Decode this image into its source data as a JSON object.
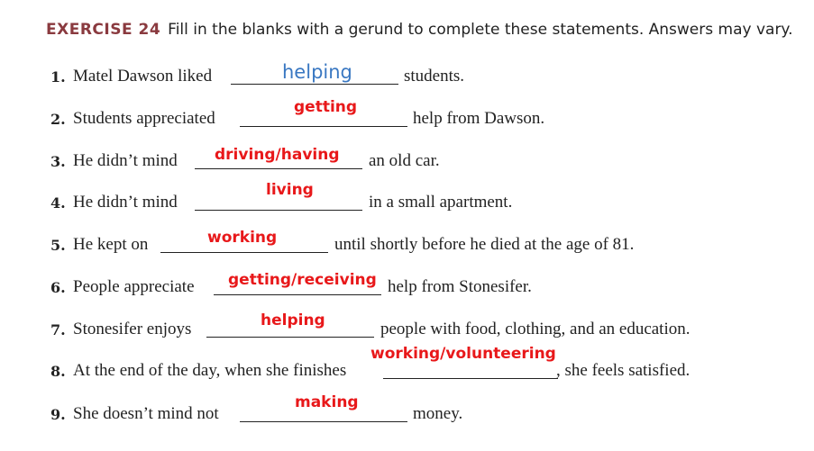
{
  "header": {
    "label": "EXERCISE 24",
    "instruction": "Fill in the blanks with a gerund to complete these statements. Answers may vary."
  },
  "items": [
    {
      "number": "1.",
      "before": "Matel Dawson liked",
      "answer": "helping",
      "after": "students."
    },
    {
      "number": "2.",
      "before": "Students appreciated",
      "answer": "getting",
      "after": "help from Dawson."
    },
    {
      "number": "3.",
      "before": "He didn’t mind",
      "answer": "driving/having",
      "after": "an old car."
    },
    {
      "number": "4.",
      "before": "He didn’t mind",
      "answer": "living",
      "after": "in a small apartment."
    },
    {
      "number": "5.",
      "before": "He kept on",
      "answer": "working",
      "after": "until shortly before he died at the age of 81."
    },
    {
      "number": "6.",
      "before": "People appreciate",
      "answer": "getting/receiving",
      "after": "help from Stonesifer."
    },
    {
      "number": "7.",
      "before": "Stonesifer enjoys",
      "answer": "helping",
      "after": "people with food, clothing, and an education."
    },
    {
      "number": "8.",
      "before": "At the end of the day, when she finishes",
      "answer": "working/volunteering",
      "after": ", she feels satisfied."
    },
    {
      "number": "9.",
      "before": "She doesn’t mind not",
      "answer": "making",
      "after": "money."
    }
  ]
}
